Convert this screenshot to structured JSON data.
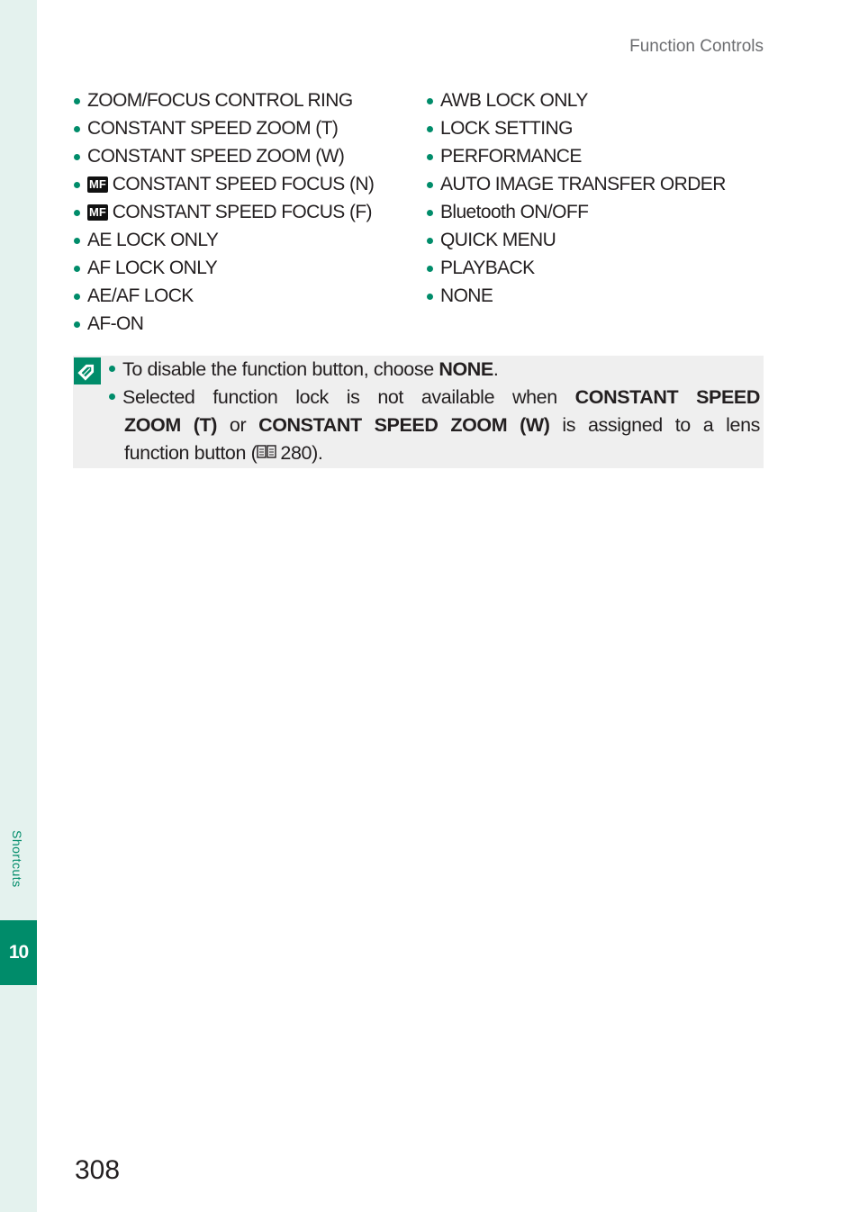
{
  "header": {
    "running_head": "Function Controls"
  },
  "sidebar": {
    "section_label": "Shortcuts",
    "chapter_number": "10"
  },
  "list_left": [
    {
      "icon": null,
      "label": "ZOOM/FOCUS CONTROL RING"
    },
    {
      "icon": null,
      "label": "CONSTANT SPEED ZOOM (T)"
    },
    {
      "icon": null,
      "label": "CONSTANT SPEED ZOOM (W)"
    },
    {
      "icon": "MF",
      "label": "CONSTANT SPEED FOCUS (N)"
    },
    {
      "icon": "MF",
      "label": "CONSTANT SPEED FOCUS (F)"
    },
    {
      "icon": null,
      "label": "AE LOCK ONLY"
    },
    {
      "icon": null,
      "label": "AF LOCK ONLY"
    },
    {
      "icon": null,
      "label": "AE/AF LOCK"
    },
    {
      "icon": null,
      "label": "AF-ON"
    }
  ],
  "list_right": [
    {
      "label": "AWB LOCK ONLY"
    },
    {
      "label": "LOCK SETTING"
    },
    {
      "label": "PERFORMANCE"
    },
    {
      "label": "AUTO IMAGE TRANSFER ORDER"
    },
    {
      "label": "Bluetooth ON/OFF"
    },
    {
      "label": "QUICK MENU"
    },
    {
      "label": "PLAYBACK"
    },
    {
      "label": "NONE"
    }
  ],
  "note": {
    "icon": "note-pencil-icon",
    "line1": {
      "text": "To disable the function button, choose ",
      "bold": "NONE",
      "end": "."
    },
    "line2": {
      "part1": "Selected function lock is not available when ",
      "bold1": "CONSTANT SPEED",
      "bold2": "ZOOM (T)",
      "part2": " or ",
      "bold3": "CONSTANT SPEED ZOOM (W)",
      "part3": " is assigned to a lens",
      "part4": "function button (",
      "page_ref": "280",
      "end": ")."
    }
  },
  "footer": {
    "page_number": "308"
  },
  "colors": {
    "accent": "#008c6a",
    "sidebar_bg": "#e4f2ee",
    "note_bg": "#efefef"
  }
}
